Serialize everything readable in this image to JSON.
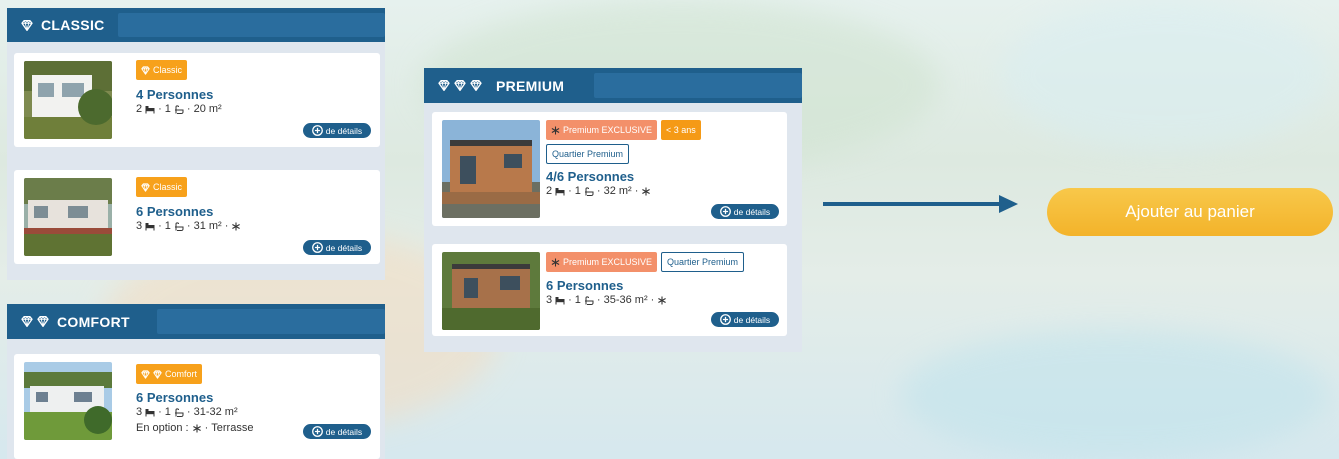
{
  "colors": {
    "header_blue": "#1f5f8c",
    "badge_classic": "#f7a11b",
    "badge_premium": "#f3906a",
    "badge_new": "#f59a16",
    "cart_button": "#f3b32a"
  },
  "classic": {
    "title": "CLASSIC",
    "icon": "diamond-icon",
    "cards": [
      {
        "badge": "Classic",
        "persons": "4 Personnes",
        "bedrooms": "2",
        "bathrooms": "1",
        "area": "20 m²",
        "details": "de détails"
      },
      {
        "badge": "Classic",
        "persons": "6 Personnes",
        "bedrooms": "3",
        "bathrooms": "1",
        "area": "31 m²",
        "extra": "·",
        "details": "de détails"
      }
    ]
  },
  "comfort": {
    "title": "COMFORT",
    "cards": [
      {
        "badge": "Comfort",
        "persons": "6 Personnes",
        "bedrooms": "3",
        "bathrooms": "1",
        "area": "31-32 m²",
        "option_label": "En option :",
        "option_extra": "Terrasse",
        "details": "de détails"
      }
    ]
  },
  "premium": {
    "title": "PREMIUM",
    "cards": [
      {
        "badge": "Premium EXCLUSIVE",
        "badge2": "< 3 ans",
        "badge3": "Quartier Premium",
        "persons": "4/6 Personnes",
        "bedrooms": "2",
        "bathrooms": "1",
        "area": "32 m²",
        "details": "de détails"
      },
      {
        "badge": "Premium EXCLUSIVE",
        "badge2": "Quartier Premium",
        "persons": "6 Personnes",
        "bedrooms": "3",
        "bathrooms": "1",
        "area": "35-36 m²",
        "details": "de détails"
      }
    ]
  },
  "cart": {
    "label": "Ajouter au panier"
  }
}
